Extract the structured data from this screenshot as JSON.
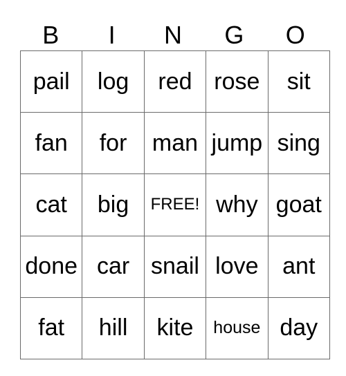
{
  "header": [
    "B",
    "I",
    "N",
    "G",
    "O"
  ],
  "rows": [
    [
      "pail",
      "log",
      "red",
      "rose",
      "sit"
    ],
    [
      "fan",
      "for",
      "man",
      "jump",
      "sing"
    ],
    [
      "cat",
      "big",
      "FREE!",
      "why",
      "goat"
    ],
    [
      "done",
      "car",
      "snail",
      "love",
      "ant"
    ],
    [
      "fat",
      "hill",
      "kite",
      "house",
      "day"
    ]
  ]
}
